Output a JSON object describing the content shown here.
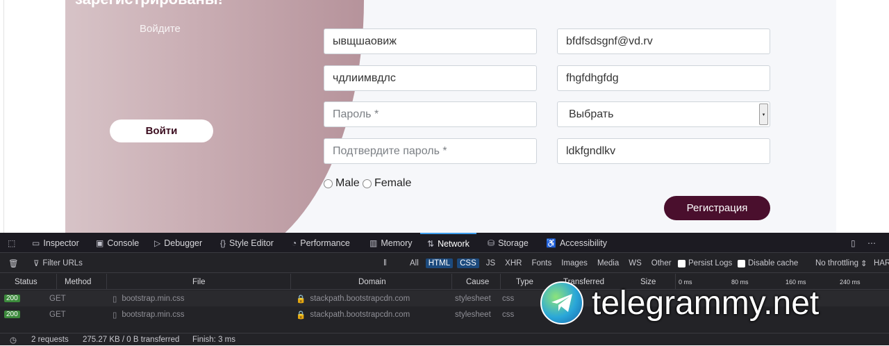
{
  "page": {
    "panel_title": "зарегистрированы!",
    "panel_subtitle": "Войдите",
    "login_button": "Войти",
    "fields": {
      "name": "ывщшаовиж",
      "email": "bfdfsdsgnf@vd.rv",
      "surname": "чдлиимвдлс",
      "login": "fhgfdhgfdg",
      "password_placeholder": "Пароль *",
      "confirm_placeholder": "Подтвердите пароль *",
      "select_value": "Выбрать",
      "extra": "ldkfgndlkv"
    },
    "gender": {
      "male": "Male",
      "female": "Female"
    },
    "register_button": "Регистрация"
  },
  "devtools": {
    "tabs": [
      {
        "label": "Inspector",
        "icon": "inspector-icon"
      },
      {
        "label": "Console",
        "icon": "console-icon"
      },
      {
        "label": "Debugger",
        "icon": "debugger-icon"
      },
      {
        "label": "Style Editor",
        "icon": "braces-icon"
      },
      {
        "label": "Performance",
        "icon": "gauge-icon"
      },
      {
        "label": "Memory",
        "icon": "memory-icon"
      },
      {
        "label": "Network",
        "icon": "network-icon"
      },
      {
        "label": "Storage",
        "icon": "storage-icon"
      },
      {
        "label": "Accessibility",
        "icon": "accessibility-icon"
      }
    ],
    "filter_placeholder": "Filter URLs",
    "filters": [
      "All",
      "HTML",
      "CSS",
      "JS",
      "XHR",
      "Fonts",
      "Images",
      "Media",
      "WS",
      "Other"
    ],
    "persist_logs": "Persist Logs",
    "disable_cache": "Disable cache",
    "throttling": "No throttling",
    "har": "HAR",
    "columns": [
      "Status",
      "Method",
      "File",
      "Domain",
      "Cause",
      "Type",
      "Transferred",
      "Size"
    ],
    "timeline": [
      "0 ms",
      "80 ms",
      "160 ms",
      "240 ms"
    ],
    "requests": [
      {
        "status": "200",
        "method": "GET",
        "file": "bootstrap.min.css",
        "domain": "stackpath.bootstrapcdn.com",
        "cause": "stylesheet",
        "type": "css"
      },
      {
        "status": "200",
        "method": "GET",
        "file": "bootstrap.min.css",
        "domain": "stackpath.bootstrapcdn.com",
        "cause": "stylesheet",
        "type": "css"
      }
    ],
    "footer": {
      "requests": "2 requests",
      "transferred": "275.27 KB / 0 B transferred",
      "finish": "Finish: 3 ms"
    }
  },
  "watermark": "telegrammy.net",
  "colors": {
    "register_button": "#4a0f2d",
    "devtools_bg": "#232327",
    "active_tab": "#3d9ded",
    "status_ok": "#3c8a3c"
  }
}
